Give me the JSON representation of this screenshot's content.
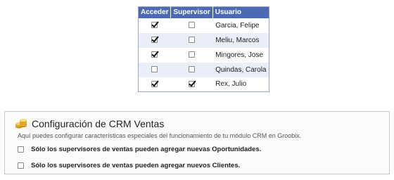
{
  "table": {
    "headers": [
      "Acceder",
      "Supervisor",
      "Usuario"
    ],
    "rows": [
      {
        "acceder": true,
        "supervisor": false,
        "usuario": "Garcia, Felipe"
      },
      {
        "acceder": true,
        "supervisor": false,
        "usuario": "Meliu, Marcos"
      },
      {
        "acceder": true,
        "supervisor": false,
        "usuario": "Mingores, Jose"
      },
      {
        "acceder": false,
        "supervisor": false,
        "usuario": "Quindas, Carola"
      },
      {
        "acceder": true,
        "supervisor": true,
        "usuario": "Rex, Julio"
      }
    ]
  },
  "config": {
    "icon": "coins-icon",
    "title": "Configuración de CRM Ventas",
    "description": "Aquí puedes configurar características especiales del funcionamiento de tu módulo CRM en Groobix.",
    "options": [
      {
        "label": "Sólo los supervisores de ventas pueden agregar nuevas Oportunidades.",
        "checked": false
      },
      {
        "label": "Sólo los supervisores de ventas pueden agregar nuevos Clientes.",
        "checked": false
      }
    ]
  },
  "colors": {
    "header_bg": "#4a6bb3",
    "alt_row_bg": "#e9eef8",
    "panel_bg": "#fbfbfb"
  }
}
